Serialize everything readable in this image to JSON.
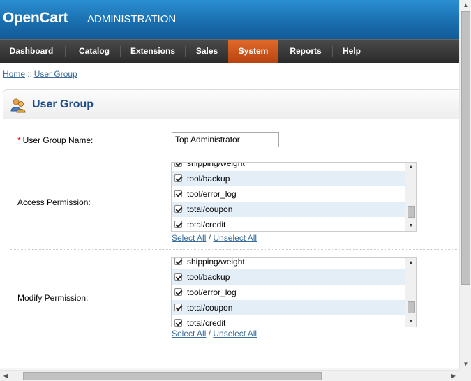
{
  "header": {
    "logo": "OpenCart",
    "subtitle": "ADMINISTRATION"
  },
  "menu": {
    "items": [
      {
        "label": "Dashboard"
      },
      {
        "label": "Catalog"
      },
      {
        "label": "Extensions"
      },
      {
        "label": "Sales"
      },
      {
        "label": "System",
        "active": true
      },
      {
        "label": "Reports"
      },
      {
        "label": "Help"
      }
    ]
  },
  "breadcrumb": {
    "home": "Home",
    "separator": "::",
    "current": "User Group"
  },
  "page": {
    "title": "User Group",
    "title_icon": "users-icon"
  },
  "form": {
    "name_label": "User Group Name:",
    "required_mark": "*",
    "name_value": "Top Administrator",
    "access_label": "Access Permission:",
    "modify_label": "Modify Permission:",
    "access_items": [
      {
        "label": "shipping/weight",
        "checked": true
      },
      {
        "label": "tool/backup",
        "checked": true
      },
      {
        "label": "tool/error_log",
        "checked": true
      },
      {
        "label": "total/coupon",
        "checked": true
      },
      {
        "label": "total/credit",
        "checked": true
      }
    ],
    "modify_items": [
      {
        "label": "shipping/weight",
        "checked": true
      },
      {
        "label": "tool/backup",
        "checked": true
      },
      {
        "label": "tool/error_log",
        "checked": true
      },
      {
        "label": "total/coupon",
        "checked": true
      },
      {
        "label": "total/credit",
        "checked": true
      }
    ],
    "select_all": "Select All",
    "unselect_all": "Unselect All",
    "link_separator": "/"
  },
  "colors": {
    "header_blue": "#1a6fb0",
    "menu_dark": "#2b2b2b",
    "menu_active": "#c9521a",
    "heading_text": "#1f4f8a",
    "alt_row": "#e4eef7"
  }
}
